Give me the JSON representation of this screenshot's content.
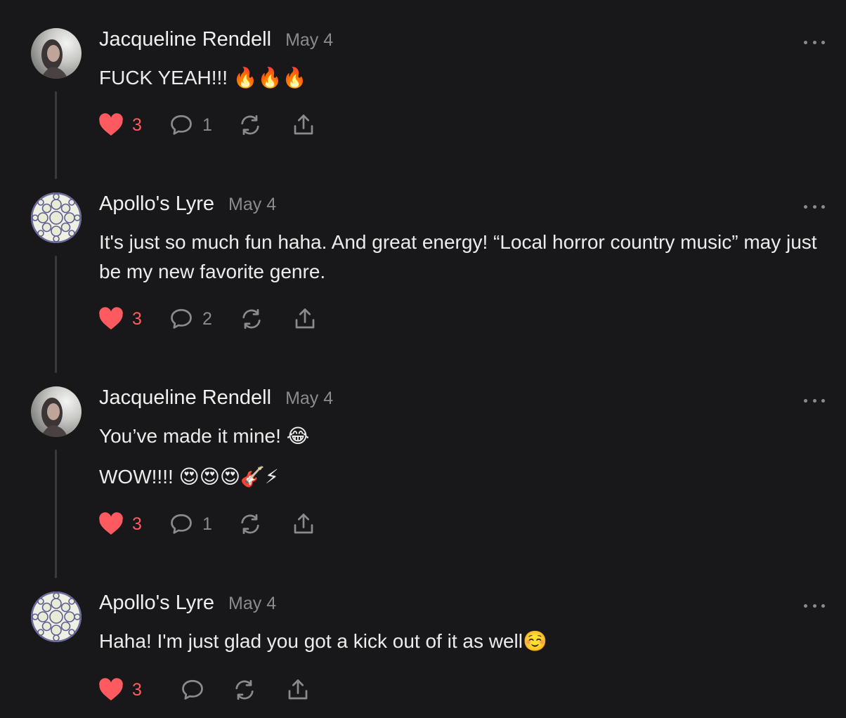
{
  "colors": {
    "background": "#18181a",
    "liked_heart": "#ff5a5f",
    "muted": "#8b8b8f",
    "thread_line": "#3a3a3d"
  },
  "comments": [
    {
      "author": "Jacqueline Rendell",
      "date": "May 4",
      "avatar": "portrait-photo",
      "paragraphs": [
        "FUCK YEAH!!! 🔥🔥🔥"
      ],
      "likes": "3",
      "replies": "1",
      "liked": true
    },
    {
      "author": "Apollo's Lyre",
      "date": "May 4",
      "avatar": "mandala-pattern",
      "paragraphs": [
        "It's just so much fun haha. And great energy! “Local horror country music” may just be my new favorite genre."
      ],
      "likes": "3",
      "replies": "2",
      "liked": true
    },
    {
      "author": "Jacqueline Rendell",
      "date": "May 4",
      "avatar": "portrait-photo",
      "paragraphs": [
        "You’ve made it mine! 😂",
        "WOW!!!! 😍😍😍🎸⚡"
      ],
      "likes": "3",
      "replies": "1",
      "liked": true
    },
    {
      "author": "Apollo's Lyre",
      "date": "May 4",
      "avatar": "mandala-pattern",
      "paragraphs": [
        "Haha! I'm just glad you got a kick out of it as well☺️"
      ],
      "likes": "3",
      "replies": "",
      "liked": true
    }
  ]
}
